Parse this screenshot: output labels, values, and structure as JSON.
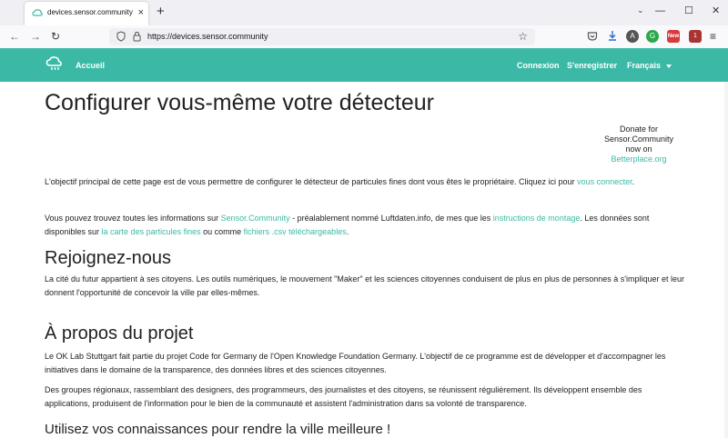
{
  "browser": {
    "tab_title": "devices.sensor.community | configurer",
    "tab_close": "×",
    "new_tab": "+",
    "url": "https://devices.sensor.community",
    "back": "←",
    "forward": "→",
    "reload": "↻",
    "star": "☆",
    "menu": "≡",
    "win_minimize": "—",
    "win_maximize": "☐",
    "win_close": "✕",
    "list_tabs": "⌄",
    "ext_badge_new": "New",
    "ext_badge_count": "1",
    "ext_icon_a": "A",
    "ext_icon_b": "G"
  },
  "site_nav": {
    "home": "Accueil",
    "login": "Connexion",
    "register": "S'enregistrer",
    "language": "Français"
  },
  "page": {
    "title": "Configurer vous-même votre détecteur",
    "donate": {
      "line1": "Donate for",
      "line2": "Sensor.Community",
      "line3": "now on",
      "link": "Betterplace.org"
    },
    "intro": {
      "text1": "L'objectif principal de cette page est de vous permettre de configurer le détecteur de particules fines dont vous êtes le propriétaire. Cliquez ici pour ",
      "link": "vous connecter",
      "text2": "."
    },
    "info": {
      "text1": "Vous pouvez trouvez toutes les informations sur ",
      "link1": "Sensor.Community",
      "text2": " - préalablement nommé Luftdaten.info, de mes que les ",
      "link2": "instructions de montage",
      "text3": ". Les données sont disponibles sur ",
      "link3": "la carte des particules fines",
      "text4": " ou comme ",
      "link4": "fichiers .csv téléchargeables",
      "text5": "."
    },
    "join_heading": "Rejoignez-nous",
    "join_text": "La cité du futur appartient à ses citoyens. Les outils numériques, le mouvement \"Maker\" et les sciences citoyennes conduisent de plus en plus de personnes à s'impliquer et leur donnent l'opportunité de concevoir la ville par elles-mêmes.",
    "about_heading": "À propos du projet",
    "about_text1": "Le OK Lab Stuttgart fait partie du projet Code for Germany de l'Open Knowledge Foundation Germany. L'objectif de ce programme est de développer et d'accompagner les initiatives dans le domaine de la transparence, des données libres et des sciences citoyennes.",
    "about_text2": "Des groupes régionaux, rassemblant des designers, des programmeurs, des journalistes et des citoyens, se réunissent régulièrement. Ils développent ensemble des applications, produisent de l'information pour le bien de la communauté et assistent l'administration dans sa volonté de transparence.",
    "use_heading": "Utilisez vos connaissances pour rendre la ville meilleure !"
  },
  "colors": {
    "accent": "#3bb9a6"
  }
}
